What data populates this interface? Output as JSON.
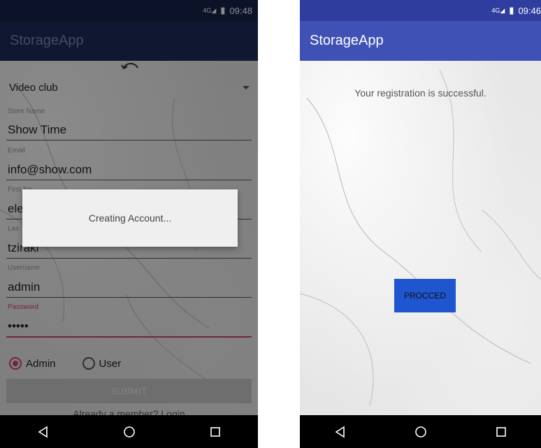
{
  "left": {
    "status": {
      "network": "4G",
      "time": "09:48"
    },
    "app_title": "StorageApp",
    "store_type": "Video club",
    "fields": [
      {
        "label": "Store Name",
        "value": "Show Time"
      },
      {
        "label": "Email",
        "value": "info@show.com"
      },
      {
        "label": "First Na",
        "value": "ele"
      },
      {
        "label": "Las",
        "value": "tziraki"
      },
      {
        "label": "Username",
        "value": "admin"
      },
      {
        "label": "Password",
        "value": "•••••"
      }
    ],
    "role": {
      "admin_label": "Admin",
      "user_label": "User",
      "selected": "Admin"
    },
    "submit_label": "SUBMIT",
    "login_link": "Already a member? Login",
    "dialog_message": "Creating Account..."
  },
  "right": {
    "status": {
      "network": "4G",
      "time": "09:46"
    },
    "app_title": "StorageApp",
    "message": "Your registration is successful.",
    "proceed_label": "PROCCED"
  },
  "colors": {
    "primary": "#3f51b5",
    "primary_dark": "#2f3d9e",
    "accent": "#d0466b",
    "button_blue": "#1f55cf"
  },
  "icons": {
    "back": "back-triangle-icon",
    "home": "home-circle-icon",
    "recents": "recents-square-icon"
  }
}
